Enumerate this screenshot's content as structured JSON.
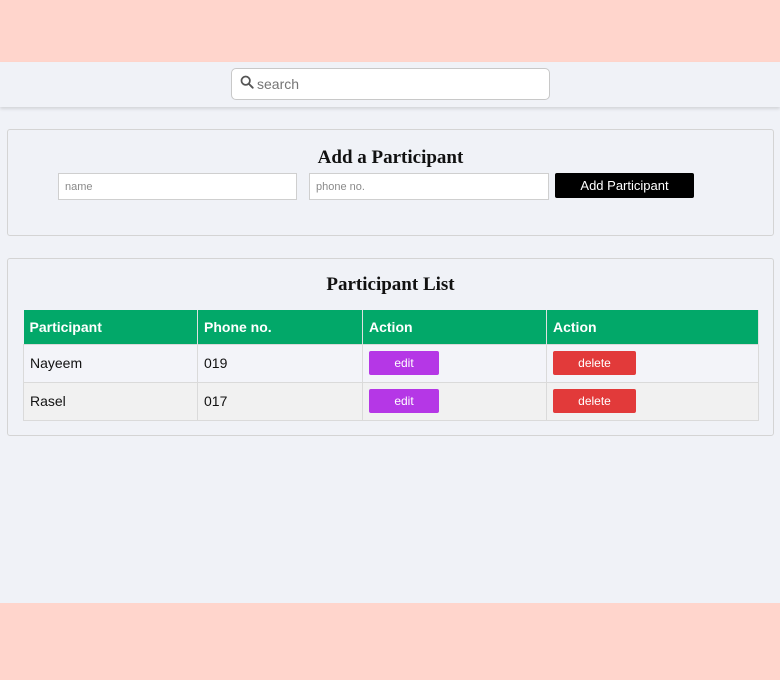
{
  "search": {
    "placeholder": "search",
    "icon": "search-icon"
  },
  "add_form": {
    "title": "Add a Participant",
    "name_placeholder": "name",
    "phone_placeholder": "phone no.",
    "submit_label": "Add Participant"
  },
  "list": {
    "title": "Participant List",
    "columns": [
      "Participant",
      "Phone no.",
      "Action",
      "Action"
    ],
    "rows": [
      {
        "name": "Nayeem",
        "phone": "019",
        "edit_label": "edit",
        "delete_label": "delete"
      },
      {
        "name": "Rasel",
        "phone": "017",
        "edit_label": "edit",
        "delete_label": "delete"
      }
    ]
  },
  "colors": {
    "page_background": "#ffd5cc",
    "app_background": "#f0f2f7",
    "table_header": "#02a869",
    "edit_button": "#b537e6",
    "delete_button": "#e23a3a",
    "add_button": "#000000"
  }
}
